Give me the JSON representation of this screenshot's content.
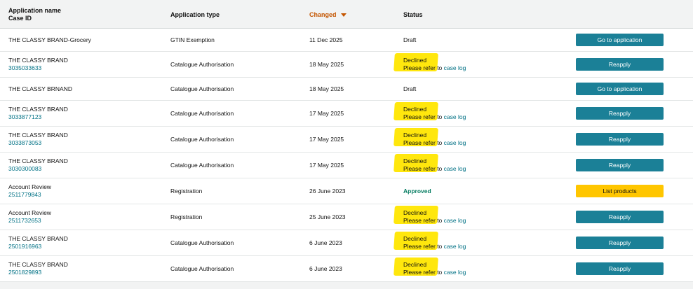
{
  "header": {
    "name_label": "Application name",
    "case_label": "Case ID",
    "type_label": "Application type",
    "changed_label": "Changed",
    "status_label": "Status"
  },
  "common": {
    "refer_prefix": "Please refer to",
    "case_log": "case log"
  },
  "rows": [
    {
      "name": "THE CLASSY BRAND-Grocery",
      "case_id": "",
      "type": "GTIN Exemption",
      "changed": "11 Dec 2025",
      "status": "Draft",
      "action": "Go to application"
    },
    {
      "name": "THE CLASSY BRAND",
      "case_id": "3035033633",
      "type": "Catalogue Authorisation",
      "changed": "18 May 2025",
      "status": "Declined",
      "action": "Reapply"
    },
    {
      "name": "THE CLASSY BRNAND",
      "case_id": "",
      "type": "Catalogue Authorisation",
      "changed": "18 May 2025",
      "status": "Draft",
      "action": "Go to application"
    },
    {
      "name": "THE CLASSY BRAND",
      "case_id": "3033877123",
      "type": "Catalogue Authorisation",
      "changed": "17 May 2025",
      "status": "Declined",
      "action": "Reapply"
    },
    {
      "name": "THE CLASSY BRAND",
      "case_id": "3033873053",
      "type": "Catalogue Authorisation",
      "changed": "17 May 2025",
      "status": "Declined",
      "action": "Reapply"
    },
    {
      "name": "THE CLASSY BRAND",
      "case_id": "3030300083",
      "type": "Catalogue Authorisation",
      "changed": "17 May 2025",
      "status": "Declined",
      "action": "Reapply"
    },
    {
      "name": "Account Review",
      "case_id": "2511779843",
      "type": "Registration",
      "changed": "26 June 2023",
      "status": "Approved",
      "action": "List products"
    },
    {
      "name": "Account Review",
      "case_id": "2511732653",
      "type": "Registration",
      "changed": "25 June 2023",
      "status": "Declined",
      "action": "Reapply"
    },
    {
      "name": "THE CLASSY BRAND",
      "case_id": "2501916963",
      "type": "Catalogue Authorisation",
      "changed": "6 June 2023",
      "status": "Declined",
      "action": "Reapply"
    },
    {
      "name": "THE CLASSY BRAND",
      "case_id": "2501829893",
      "type": "Catalogue Authorisation",
      "changed": "6 June 2023",
      "status": "Declined",
      "action": "Reapply"
    }
  ],
  "colors": {
    "teal_button": "#1b8097",
    "yellow_button": "#ffc600",
    "highlight": "#ffe600",
    "link": "#007185",
    "sort_accent": "#c45500",
    "approved": "#067d62"
  }
}
